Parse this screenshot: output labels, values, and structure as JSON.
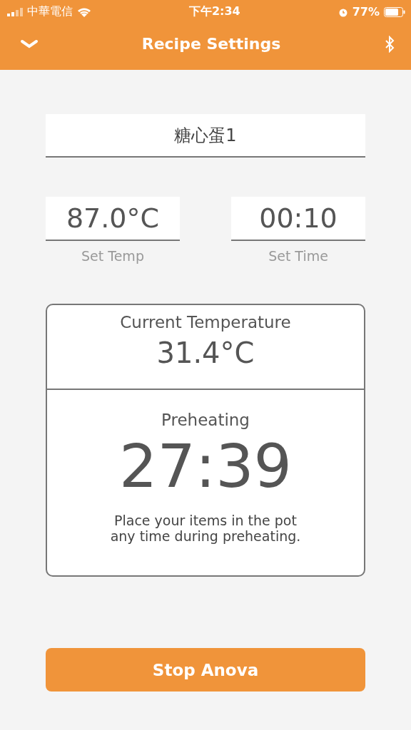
{
  "status_bar": {
    "carrier": "中華電信",
    "time": "下午2:34",
    "battery": "77%"
  },
  "header": {
    "title": "Recipe Settings"
  },
  "recipe_name": {
    "value": "糖心蛋1"
  },
  "settings": [
    {
      "value": "87.0°C",
      "label": "Set Temp"
    },
    {
      "value": "00:10",
      "label": "Set Time"
    }
  ],
  "card": {
    "current_label": "Current Temperature",
    "current_value": "31.4°C",
    "phase": "Preheating",
    "timer": "27:39",
    "note_lines": [
      "Place your items in the pot",
      "any time during preheating."
    ]
  },
  "action_button": {
    "label": "Stop Anova"
  }
}
